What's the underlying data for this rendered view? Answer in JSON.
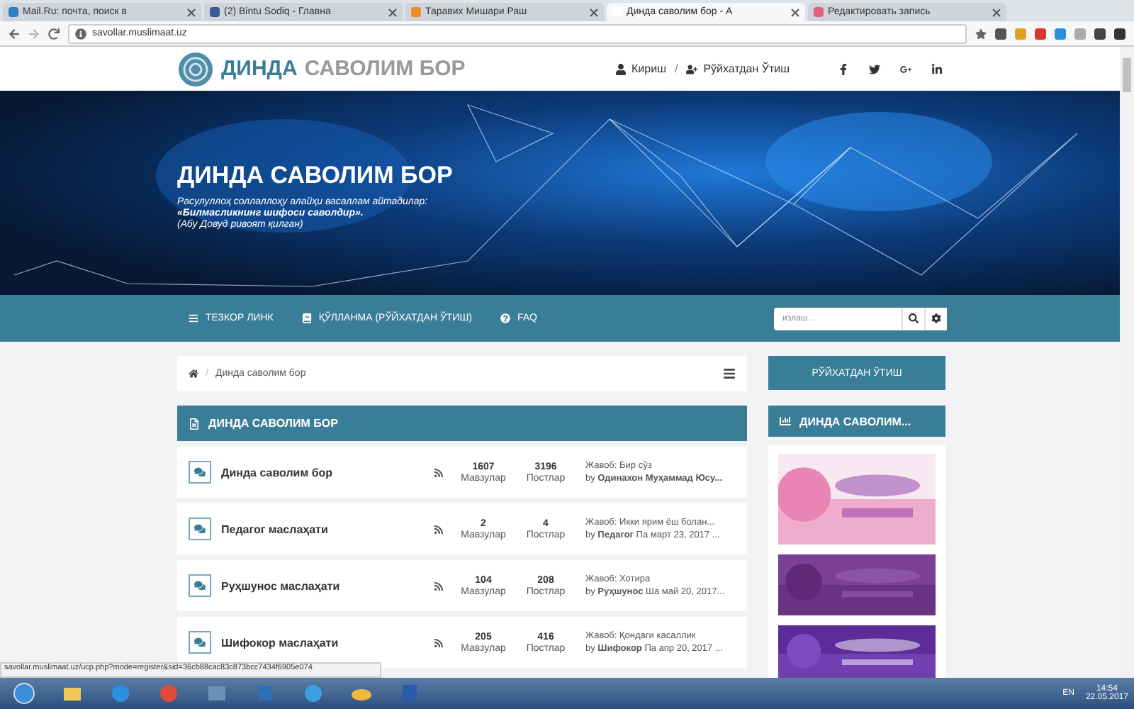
{
  "browser": {
    "tabs": [
      {
        "title": "Mail.Ru: почта, поиск в",
        "selected": false
      },
      {
        "title": "(2) Bintu Sodiq - Главна",
        "selected": false
      },
      {
        "title": "Таравих Мишари Раш",
        "selected": false
      },
      {
        "title": "Динда саволим бор - А",
        "selected": true
      },
      {
        "title": "Редактировать запись",
        "selected": false
      }
    ],
    "address": "savollar.muslimaat.uz",
    "status_url": "savollar.muslimaat.uz/ucp.php?mode=register&sid=36cb88cac83c873bcc7434f6905e074"
  },
  "header": {
    "logo": {
      "primary": "ДИНДА",
      "secondary": "САВОЛИМ БОР"
    },
    "login": "Кириш",
    "separator": "/",
    "register": "Рўйхатдан Ўтиш"
  },
  "banner": {
    "title": "ДИНДА САВОЛИМ БОР",
    "lines": [
      {
        "text": "Расулуллоҳ соллаллоҳу алайҳи васаллам айтадилар:",
        "bold": false
      },
      {
        "text": "«Билмасликнинг шифоси саволдир».",
        "bold": true
      },
      {
        "text": "(Абу Довуд ривоят қилган)",
        "bold": false
      }
    ]
  },
  "nav": {
    "items": [
      {
        "label": "ТЕЗКОР ЛИНК",
        "kind": "menu"
      },
      {
        "label": "ҚЎЛЛАНМА (РЎЙХАТДАН ЎТИШ)",
        "kind": "guide"
      },
      {
        "label": "FAQ",
        "kind": "help"
      }
    ],
    "search": {
      "placeholder": "излаш..."
    }
  },
  "breadcrumb": {
    "separator": "/",
    "items": [
      "Динда саволим бор"
    ]
  },
  "forum": {
    "title": "ДИНДА САВОЛИМ БОР",
    "rows": [
      {
        "name": "Динда саволим бор",
        "topics": "1607",
        "topics_label": "Мавзулар",
        "posts": "3196",
        "posts_label": "Постлар",
        "last_title": "Жавоб: Бир сўз",
        "last_by": "by **Одинахон Муҳаммад Юсу...**"
      },
      {
        "name": "Педагог маслаҳати",
        "topics": "2",
        "topics_label": "Мавзулар",
        "posts": "4",
        "posts_label": "Постлар",
        "last_title": "Жавоб: Икки ярим ёш болан...",
        "last_by": "by **Педагог** Па март 23, 2017 ..."
      },
      {
        "name": "Руҳшунос маслаҳати",
        "topics": "104",
        "topics_label": "Мавзулар",
        "posts": "208",
        "posts_label": "Постлар",
        "last_title": "Жавоб: Хотира",
        "last_by": "by **Руҳшунос** Ша май 20, 2017..."
      },
      {
        "name": "Шифокор маслаҳати",
        "topics": "205",
        "topics_label": "Мавзулар",
        "posts": "416",
        "posts_label": "Постлар",
        "last_title": "Жавоб: Қондаги касаллик",
        "last_by": "by **Шифокор** Па апр 20, 2017 ..."
      }
    ]
  },
  "sidebar": {
    "register_button": "РЎЙХАТДАН ЎТИШ",
    "panel_title": "ДИНДА САВОЛИМ..."
  },
  "taskbar": {
    "language": "EN",
    "time": "14:54",
    "date": "22.05.2017"
  }
}
